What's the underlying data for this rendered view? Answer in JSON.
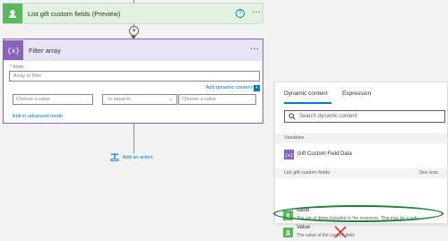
{
  "flow": {
    "step1": {
      "title": "List gift custom fields (Preview)",
      "help": "?",
      "more": "···"
    },
    "step2": {
      "title": "Filter array",
      "more": "···",
      "from_label": "* From",
      "from_placeholder": "Array to filter",
      "add_dynamic_label": "Add dynamic content",
      "add_dynamic_badge": "+",
      "choose_value_left": "Choose a value",
      "operator": "is equal to",
      "choose_value_right": "Choose a value",
      "advanced_link": "Edit in advanced mode"
    },
    "add_step_plus": "+",
    "add_action_label": "Add an action"
  },
  "panel": {
    "tabs": [
      "Dynamic content",
      "Expression"
    ],
    "search_placeholder": "Search dynamic content",
    "variables_label": "Variables",
    "variable_item": "Gift Custom Field Data",
    "section_label": "List gift custom fields",
    "see_less": "See less",
    "items": [
      {
        "title": "value",
        "desc": "The set of items included in the response. This may be a sub..."
      },
      {
        "title": "Value",
        "desc": "The value of the custom field."
      }
    ]
  },
  "colors": {
    "accent": "#0078d4",
    "filter_purple": "#8764b8",
    "step_green": "#5cb85c",
    "highlight_green": "#1a7f37",
    "cross_red": "#d13438"
  }
}
